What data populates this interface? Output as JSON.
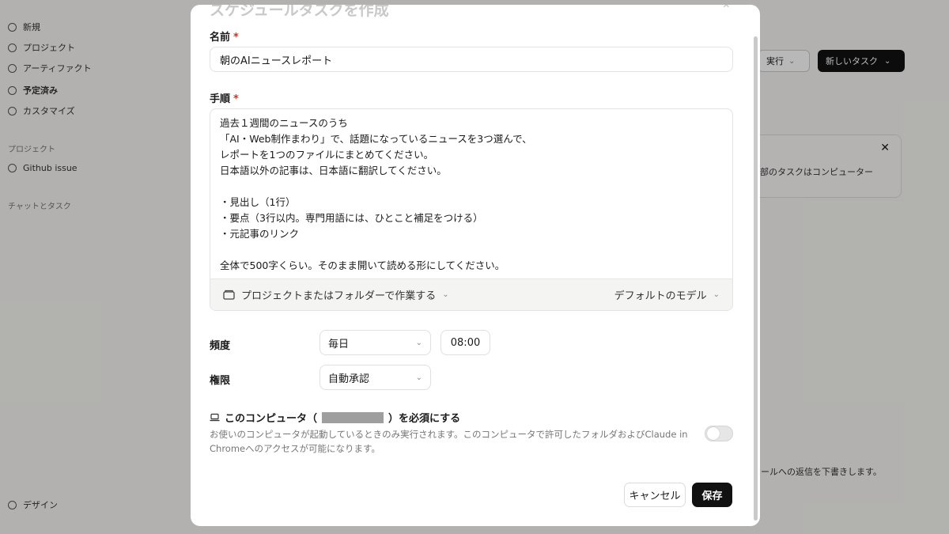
{
  "background": {
    "sidebar_items": [
      "新規",
      "プロジェクト",
      "アーティファクト",
      "予定済み",
      "カスタマイズ"
    ],
    "section_projects": "プロジェクト",
    "project_item": "Github issue",
    "section_chats": "チャットとタスク",
    "footer_item": "デザイン",
    "run_button": "実行",
    "new_task_button": "新しいタスク",
    "card_text": "部のタスクはコンピューター",
    "bottom_text": "ールへの返信を下書きします。"
  },
  "modal": {
    "title": "スケジュールタスクを作成",
    "name_label": "名前",
    "name_value": "朝のAIニュースレポート",
    "steps_label": "手順",
    "steps_text": "過去１週間のニュースのうち\n「AI・Web制作まわり」で、話題になっているニュースを3つ選んで、\nレポートを1つのファイルにまとめてください。\n日本語以外の記事は、日本語に翻訳してください。\n\n・見出し（1行）\n・要点（3行以内。専門用語には、ひとこと補足をつける）\n・元記事のリンク\n\n全体で500字くらい。そのまま開いて読める形にしてください。",
    "folder_button": "プロジェクトまたはフォルダーで作業する",
    "model_button": "デフォルトのモデル",
    "frequency_label": "頻度",
    "frequency_value": "毎日",
    "time_value": "08:00",
    "permission_label": "権限",
    "permission_value": "自動承認",
    "require_prefix": "このコンピュータ（",
    "require_suffix": "）を必須にする",
    "require_desc": "お使いのコンピュータが起動しているときのみ実行されます。このコンピュータで許可したフォルダおよびClaude in Chromeへのアクセスが可能になります。",
    "require_enabled": false,
    "cancel_label": "キャンセル",
    "save_label": "保存",
    "required_mark": "*"
  }
}
